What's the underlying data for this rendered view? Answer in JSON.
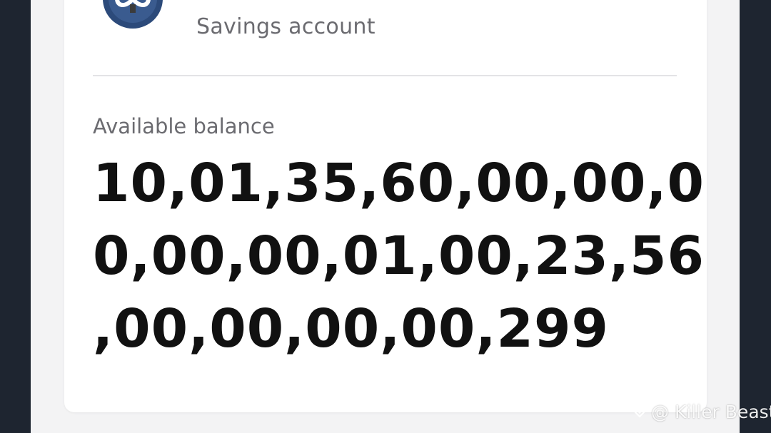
{
  "account": {
    "type_label": "Savings account",
    "logo_icon": "bank-logo-icon"
  },
  "balance": {
    "label": "Available balance",
    "amount_lines": [
      "10,01,35,60,00,00,0",
      "0,00,00,01,00,23,56",
      ",00,00,00,00,299"
    ]
  },
  "watermark": {
    "text": "@ Killer Beast",
    "icon": "diamond-icon"
  },
  "colors": {
    "logo_navy": "#2c4a7a",
    "label_gray": "#6b6b70",
    "amount_black": "#111111"
  }
}
